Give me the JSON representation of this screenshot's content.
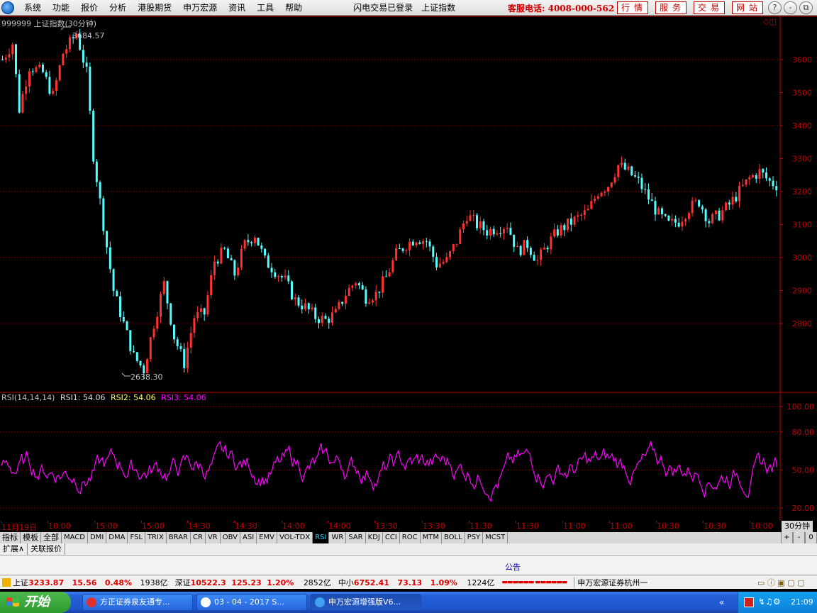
{
  "menu": {
    "items": [
      "系统",
      "功能",
      "报价",
      "分析",
      "港股期货",
      "申万宏源",
      "资讯",
      "工具",
      "帮助"
    ],
    "status": "闪电交易已登录",
    "index_name": "上证指数",
    "hotline": "客服电话: 4008-000-562",
    "right_buttons": [
      "行情",
      "服务",
      "交易",
      "网站"
    ],
    "window_buttons": [
      "?",
      "-",
      "⧉",
      "×"
    ]
  },
  "chart_header": {
    "code_name": "999999 上证指数(30分钟)",
    "high_label": "3684.57",
    "low_label": "2638.30"
  },
  "rsi_header": {
    "name": "RSI(14,14,14)",
    "rsi1_label": "RSI1:",
    "rsi1_value": "54.06",
    "rsi2_label": "RSI2:",
    "rsi2_value": "54.06",
    "rsi3_label": "RSI3:",
    "rsi3_value": "54.06"
  },
  "time_axis": {
    "labels": [
      "11月19日",
      "10:00",
      "15:00",
      "15:00",
      "14:30",
      "14:30",
      "14:00",
      "14:00",
      "13:30",
      "13:30",
      "11:30",
      "11:30",
      "11:00",
      "11:00",
      "10:30",
      "10:30",
      "10:00"
    ],
    "period": "30分钟"
  },
  "indicator_tabs": [
    "指标",
    "模板",
    "全部",
    "MACD",
    "DMI",
    "DMA",
    "FSL",
    "TRIX",
    "BRAR",
    "CR",
    "VR",
    "OBV",
    "ASI",
    "EMV",
    "VOL-TDX",
    "RSI",
    "WR",
    "SAR",
    "KDJ",
    "CCI",
    "ROC",
    "MTM",
    "BOLL",
    "PSY",
    "MCST"
  ],
  "active_tab": "RSI",
  "zoom_buttons": [
    "+",
    "-",
    "0"
  ],
  "sub_tabs": [
    "扩展∧",
    "关联报价"
  ],
  "announcement": "公告",
  "ticker": {
    "sh_label": "上证",
    "sh_value": "3233.87",
    "sh_change": "15.56",
    "sh_pct": "0.48%",
    "sh_amount": "1938亿",
    "sz_label": "深证",
    "sz_value": "10522.3",
    "sz_change": "125.23",
    "sz_pct": "1.20%",
    "sz_amount": "2852亿",
    "zx_label": "中小",
    "zx_value": "6752.41",
    "zx_change": "73.13",
    "zx_pct": "1.09%",
    "zx_amount": "1224亿",
    "broker": "申万宏源证券杭州一"
  },
  "taskbar": {
    "start": "开始",
    "tasks": [
      "方正证券泉友通专...",
      "03 - 04 - 2017 S...",
      "申万宏源增强版V6..."
    ],
    "clock": "21:09"
  },
  "colors": {
    "up": "#ff3232",
    "down": "#54ffff",
    "rsi": "#ff00ff",
    "axis": "#c00000",
    "grid": "#800000"
  },
  "chart_data": [
    {
      "type": "candlestick",
      "title": "999999 上证指数(30分钟)",
      "ylim": [
        2560,
        3720
      ],
      "yticks": [
        2800,
        2900,
        3000,
        3100,
        3200,
        3300,
        3400,
        3500,
        3600
      ],
      "max": 3684.57,
      "min": 2638.3,
      "path_keypoints": [
        [
          0,
          3600
        ],
        [
          3,
          3650
        ],
        [
          5,
          3450
        ],
        [
          8,
          3580
        ],
        [
          12,
          3560
        ],
        [
          15,
          3490
        ],
        [
          18,
          3620
        ],
        [
          22,
          3680
        ],
        [
          25,
          3560
        ],
        [
          27,
          3310
        ],
        [
          30,
          3100
        ],
        [
          33,
          2900
        ],
        [
          36,
          2800
        ],
        [
          39,
          2700
        ],
        [
          42,
          2660
        ],
        [
          45,
          2800
        ],
        [
          48,
          2920
        ],
        [
          51,
          2760
        ],
        [
          54,
          2680
        ],
        [
          57,
          2820
        ],
        [
          60,
          2830
        ],
        [
          63,
          2990
        ],
        [
          66,
          3020
        ],
        [
          69,
          2950
        ],
        [
          72,
          3040
        ],
        [
          75,
          3070
        ],
        [
          78,
          2990
        ],
        [
          81,
          2960
        ],
        [
          84,
          2930
        ],
        [
          87,
          2870
        ],
        [
          90,
          2850
        ],
        [
          93,
          2820
        ],
        [
          96,
          2810
        ],
        [
          99,
          2830
        ],
        [
          102,
          2890
        ],
        [
          105,
          2930
        ],
        [
          108,
          2880
        ],
        [
          111,
          2890
        ],
        [
          114,
          2940
        ],
        [
          117,
          3010
        ],
        [
          120,
          3040
        ],
        [
          123,
          3060
        ],
        [
          126,
          3050
        ],
        [
          129,
          2980
        ],
        [
          132,
          2990
        ],
        [
          135,
          3050
        ],
        [
          138,
          3130
        ],
        [
          141,
          3100
        ],
        [
          144,
          3080
        ],
        [
          147,
          3090
        ],
        [
          150,
          3100
        ],
        [
          153,
          3020
        ],
        [
          156,
          3040
        ],
        [
          159,
          2990
        ],
        [
          162,
          3040
        ],
        [
          165,
          3080
        ],
        [
          168,
          3100
        ],
        [
          171,
          3120
        ],
        [
          174,
          3140
        ],
        [
          177,
          3200
        ],
        [
          180,
          3220
        ],
        [
          183,
          3280
        ],
        [
          186,
          3260
        ],
        [
          189,
          3230
        ],
        [
          192,
          3180
        ],
        [
          195,
          3130
        ],
        [
          198,
          3100
        ],
        [
          201,
          3110
        ],
        [
          204,
          3150
        ],
        [
          207,
          3170
        ],
        [
          210,
          3110
        ],
        [
          213,
          3130
        ],
        [
          216,
          3160
        ],
        [
          219,
          3200
        ],
        [
          222,
          3240
        ],
        [
          225,
          3260
        ],
        [
          228,
          3230
        ],
        [
          230,
          3220
        ]
      ],
      "candle_count": 231
    },
    {
      "type": "line",
      "title": "RSI(14,14,14)",
      "series": [
        {
          "name": "RSI1",
          "last": 54.06
        },
        {
          "name": "RSI2",
          "last": 54.06
        },
        {
          "name": "RSI3",
          "last": 54.06
        }
      ],
      "ylim": [
        10,
        105
      ],
      "yticks": [
        20.0,
        50.0,
        80.0,
        100.0
      ]
    }
  ]
}
